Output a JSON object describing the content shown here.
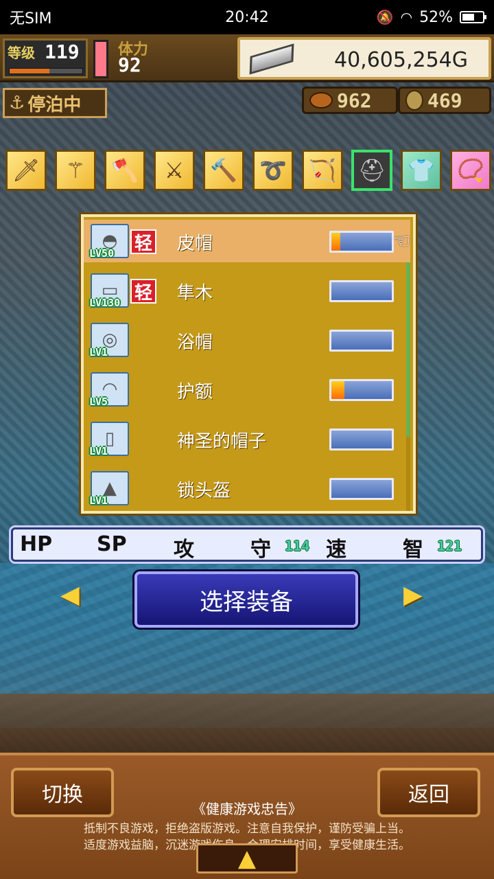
{
  "status_bar": {
    "carrier": "无SIM",
    "time": "20:42",
    "battery": "52%",
    "icons": [
      "mute-icon",
      "wifi-icon",
      "battery-icon"
    ]
  },
  "hud": {
    "level_label": "等级",
    "level": "119",
    "level_progress": 0.55,
    "stamina_label": "体力",
    "stamina": "92",
    "gold": "40,605,254G",
    "dock_status": "停泊中",
    "food": "962",
    "medals": "469"
  },
  "categories": [
    {
      "name": "sword",
      "icon": "sword-icon",
      "glyph": "🗡"
    },
    {
      "name": "staff",
      "icon": "staff-icon",
      "glyph": "⚚"
    },
    {
      "name": "axe",
      "icon": "axe-icon",
      "glyph": "🪓"
    },
    {
      "name": "spear",
      "icon": "spear-icon",
      "glyph": "⚔"
    },
    {
      "name": "hammer",
      "icon": "hammer-icon",
      "glyph": "🔨"
    },
    {
      "name": "whip",
      "icon": "whip-icon",
      "glyph": "➰"
    },
    {
      "name": "bow",
      "icon": "bow-icon",
      "glyph": "🏹"
    },
    {
      "name": "helmet",
      "icon": "helmet-icon",
      "glyph": "⛑",
      "selected": true
    },
    {
      "name": "armor",
      "icon": "armor-icon",
      "glyph": "👕"
    },
    {
      "name": "accessory",
      "icon": "accessory-icon",
      "glyph": "📿"
    }
  ],
  "equipment_list": [
    {
      "name": "皮帽",
      "level": "LV50",
      "light_tag": "轻",
      "bar_fill": 0.15,
      "selected": true
    },
    {
      "name": "隼木",
      "level": "LV130",
      "light_tag": "轻",
      "bar_fill": 0
    },
    {
      "name": "浴帽",
      "level": "LV1",
      "light_tag": "",
      "bar_fill": 0
    },
    {
      "name": "护额",
      "level": "LV5",
      "light_tag": "",
      "bar_fill": 0.22
    },
    {
      "name": "神圣的帽子",
      "level": "LV1",
      "light_tag": "",
      "bar_fill": 0
    },
    {
      "name": "锁头盔",
      "level": "LV1",
      "light_tag": "",
      "bar_fill": 0
    }
  ],
  "stats": {
    "hp_label": "HP",
    "sp_label": "SP",
    "atk_label": "攻",
    "def_label": "守",
    "def_value": "114",
    "spd_label": "速",
    "int_label": "智",
    "int_value": "121"
  },
  "select_button": "选择装备",
  "bottom": {
    "switch_button": "切换",
    "back_button": "返回",
    "notice_title": "《健康游戏忠告》",
    "notice_line1": "抵制不良游戏，拒绝盗版游戏。注意自我保护，谨防受骗上当。",
    "notice_line2": "适度游戏益脑，沉迷游戏伤身。合理安排时间，享受健康生活。"
  }
}
